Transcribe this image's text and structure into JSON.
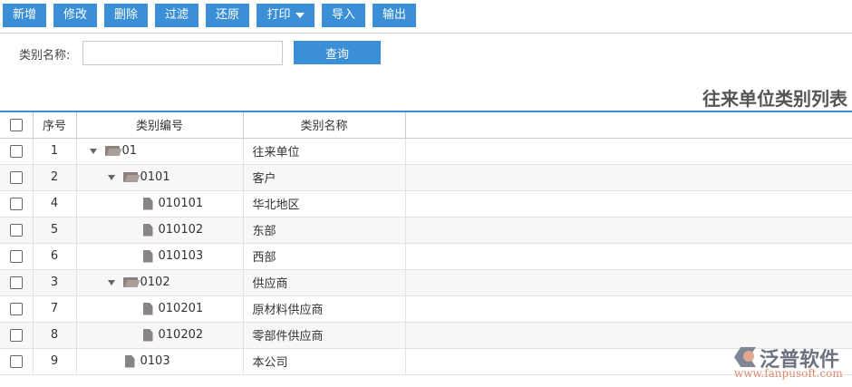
{
  "toolbar": {
    "buttons": [
      "新增",
      "修改",
      "删除",
      "过滤",
      "还原",
      "打印",
      "导入",
      "输出"
    ]
  },
  "search": {
    "label": "类别名称:",
    "value": "",
    "button": "查询"
  },
  "title": "往来单位类别列表",
  "table": {
    "headers": [
      "序号",
      "类别编号",
      "类别名称"
    ],
    "rows": [
      {
        "seq": "1",
        "code": "01",
        "name": "往来单位",
        "level": 0,
        "type": "folder"
      },
      {
        "seq": "2",
        "code": "0101",
        "name": "客户",
        "level": 1,
        "type": "folder"
      },
      {
        "seq": "4",
        "code": "010101",
        "name": "华北地区",
        "level": 2,
        "type": "file"
      },
      {
        "seq": "5",
        "code": "010102",
        "name": "东部",
        "level": 2,
        "type": "file"
      },
      {
        "seq": "6",
        "code": "010103",
        "name": "西部",
        "level": 2,
        "type": "file"
      },
      {
        "seq": "3",
        "code": "0102",
        "name": "供应商",
        "level": 1,
        "type": "folder"
      },
      {
        "seq": "7",
        "code": "010201",
        "name": "原材料供应商",
        "level": 2,
        "type": "file"
      },
      {
        "seq": "8",
        "code": "010202",
        "name": "零部件供应商",
        "level": 2,
        "type": "file"
      },
      {
        "seq": "9",
        "code": "0103",
        "name": "本公司",
        "level": 1,
        "type": "file"
      }
    ]
  },
  "logo": {
    "name": "泛普软件",
    "url": "www.fanpusoft.com"
  }
}
